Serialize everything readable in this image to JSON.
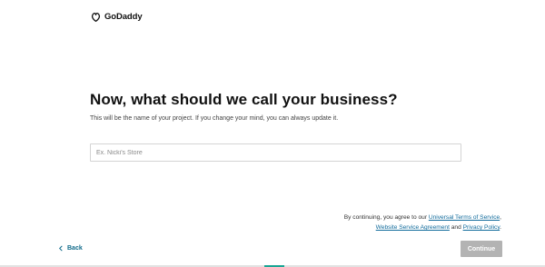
{
  "header": {
    "brand_name": "GoDaddy",
    "brand_icon": "godaddy-logo-icon"
  },
  "main": {
    "heading": "Now, what should we call your business?",
    "subtext": "This will be the name of your project. If you change your mind, you can always update it.",
    "business_name_input": {
      "value": "",
      "placeholder": "Ex. Nicki's Store"
    }
  },
  "terms": {
    "prefix": "By continuing, you agree to our ",
    "terms_link": "Universal Terms of Service",
    "comma": ",",
    "agreement_link": "Website Service Agreement",
    "and_text": " and ",
    "privacy_link": "Privacy Policy",
    "period": "."
  },
  "footer": {
    "back_label": "Back",
    "back_icon": "chevron-left-icon",
    "continue_label": "Continue"
  },
  "colors": {
    "link": "#0f6a9b",
    "continue_disabled": "#b3b3b3",
    "progress_accent": "#1aa594"
  }
}
